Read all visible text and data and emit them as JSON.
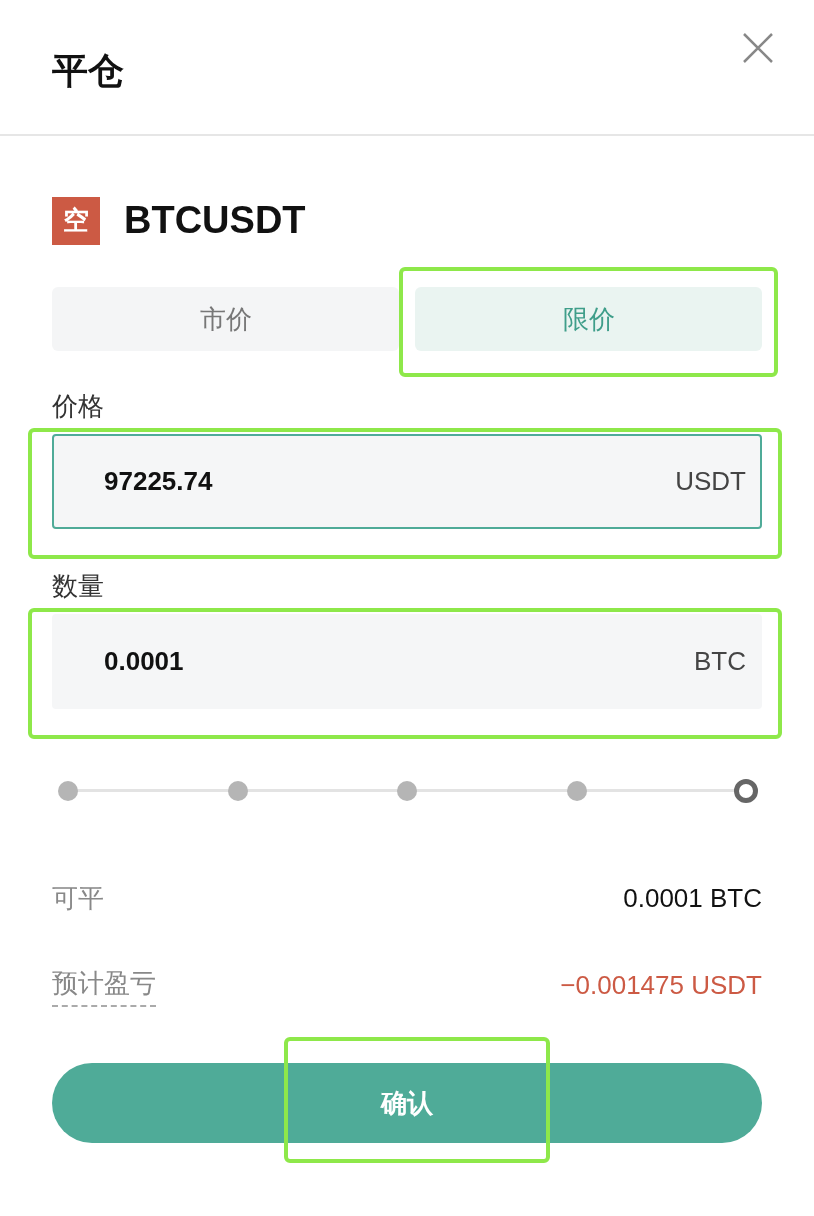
{
  "header": {
    "title": "平仓"
  },
  "position": {
    "side": "空",
    "symbol": "BTCUSDT"
  },
  "order_types": [
    {
      "label": "市价",
      "selected": false,
      "highlighted": false
    },
    {
      "label": "限价",
      "selected": true,
      "highlighted": true
    }
  ],
  "fields": [
    {
      "label": "价格",
      "value": "97225.74",
      "unit": "USDT",
      "focused": true,
      "highlighted": true
    },
    {
      "label": "数量",
      "value": "0.0001",
      "unit": "BTC",
      "focused": false,
      "highlighted": true
    }
  ],
  "slider": {
    "level": 1
  },
  "info_rows": [
    {
      "label": "可平",
      "value": "0.0001 BTC",
      "kind": "plain",
      "color": "#111111"
    },
    {
      "label": "预计盈亏",
      "value": "−0.001475 USDT",
      "kind": "dotted",
      "color": "#cc5a44"
    }
  ],
  "confirm": {
    "label": "确认",
    "highlighted": true
  }
}
